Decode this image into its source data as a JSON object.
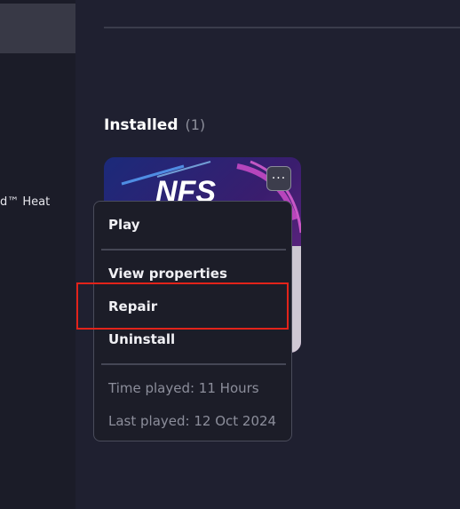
{
  "sidebar": {
    "game_label": "d™ Heat"
  },
  "section": {
    "title": "Installed",
    "count": "(1)"
  },
  "game": {
    "logo_text": "NFS",
    "more_button_label": "···"
  },
  "menu": {
    "play": "Play",
    "view_properties": "View properties",
    "repair": "Repair",
    "uninstall": "Uninstall",
    "time_played": "Time played: 11 Hours",
    "last_played": "Last played: 12 Oct 2024"
  },
  "colors": {
    "background": "#1f2030",
    "menu_background": "#1c1d28",
    "highlight": "#e2231a"
  }
}
